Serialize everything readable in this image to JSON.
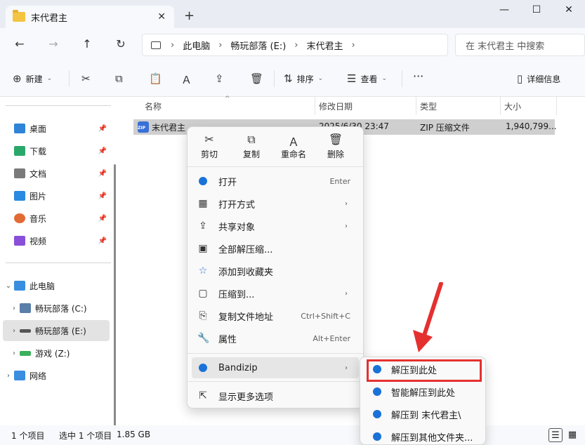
{
  "window": {
    "tab_title": "末代君主",
    "new_tab_icon": "+",
    "tab_close_icon": "✕",
    "minimize_icon": "—",
    "maximize_icon": "☐",
    "close_icon": "✕"
  },
  "nav": {
    "back": "←",
    "forward": "→",
    "up": "↑",
    "refresh": "↻",
    "breadcrumb": [
      "此电脑",
      "畅玩部落 (E:)",
      "末代君主"
    ],
    "search_placeholder": "在 末代君主 中搜索"
  },
  "toolbar": {
    "new_label": "新建",
    "sort_label": "排序",
    "view_label": "查看",
    "more": "···",
    "details_label": "详细信息"
  },
  "sidebar": {
    "quick_access": [
      {
        "label": "桌面",
        "color": "#2f84d8"
      },
      {
        "label": "下载",
        "color": "#2aa86b"
      },
      {
        "label": "文档",
        "color": "#7a7a7a"
      },
      {
        "label": "图片",
        "color": "#2a89e0"
      },
      {
        "label": "音乐",
        "color": "#e26b35"
      },
      {
        "label": "视频",
        "color": "#8a4fd8"
      }
    ],
    "this_pc": "此电脑",
    "drives": [
      "畅玩部落 (C:)",
      "畅玩部落 (E:)",
      "游戏 (Z:)"
    ],
    "network": "网络"
  },
  "columns": {
    "name": "名称",
    "modified": "修改日期",
    "type": "类型",
    "size": "大小"
  },
  "file": {
    "name": "末代君主",
    "modified": "2025/6/30 23:47",
    "type": "ZIP 压缩文件",
    "size": "1,940,799..."
  },
  "context_menu": {
    "quick_actions": [
      {
        "icon": "✂",
        "label": "剪切"
      },
      {
        "icon": "⧉",
        "label": "复制"
      },
      {
        "icon": "Ａ",
        "label": "重命名"
      },
      {
        "icon": "🗑",
        "label": "删除"
      }
    ],
    "items": [
      {
        "icon": "bz",
        "label": "打开",
        "shortcut": "Enter",
        "arrow": ""
      },
      {
        "icon": "▦",
        "label": "打开方式",
        "shortcut": "",
        "arrow": "›"
      },
      {
        "icon": "⇪",
        "label": "共享对象",
        "shortcut": "",
        "arrow": "›"
      },
      {
        "icon": "▣",
        "label": "全部解压缩...",
        "shortcut": "",
        "arrow": ""
      },
      {
        "icon": "☆",
        "label": "添加到收藏夹",
        "shortcut": "",
        "arrow": ""
      },
      {
        "icon": "▢",
        "label": "压缩到...",
        "shortcut": "",
        "arrow": "›"
      },
      {
        "icon": "⎘",
        "label": "复制文件地址",
        "shortcut": "Ctrl+Shift+C",
        "arrow": ""
      },
      {
        "icon": "🔧",
        "label": "属性",
        "shortcut": "Alt+Enter",
        "arrow": ""
      }
    ],
    "bandizip": {
      "label": "Bandizip",
      "arrow": "›"
    },
    "more_options": {
      "icon": "⇱",
      "label": "显示更多选项"
    }
  },
  "submenu": {
    "items": [
      "解压到此处",
      "智能解压到此处",
      "解压到 末代君主\\",
      "解压到其他文件夹..."
    ],
    "highlight_color": "#e53030"
  },
  "status": {
    "items_count": "1 个项目",
    "selected": "选中 1 个项目",
    "size": "1.85 GB"
  }
}
